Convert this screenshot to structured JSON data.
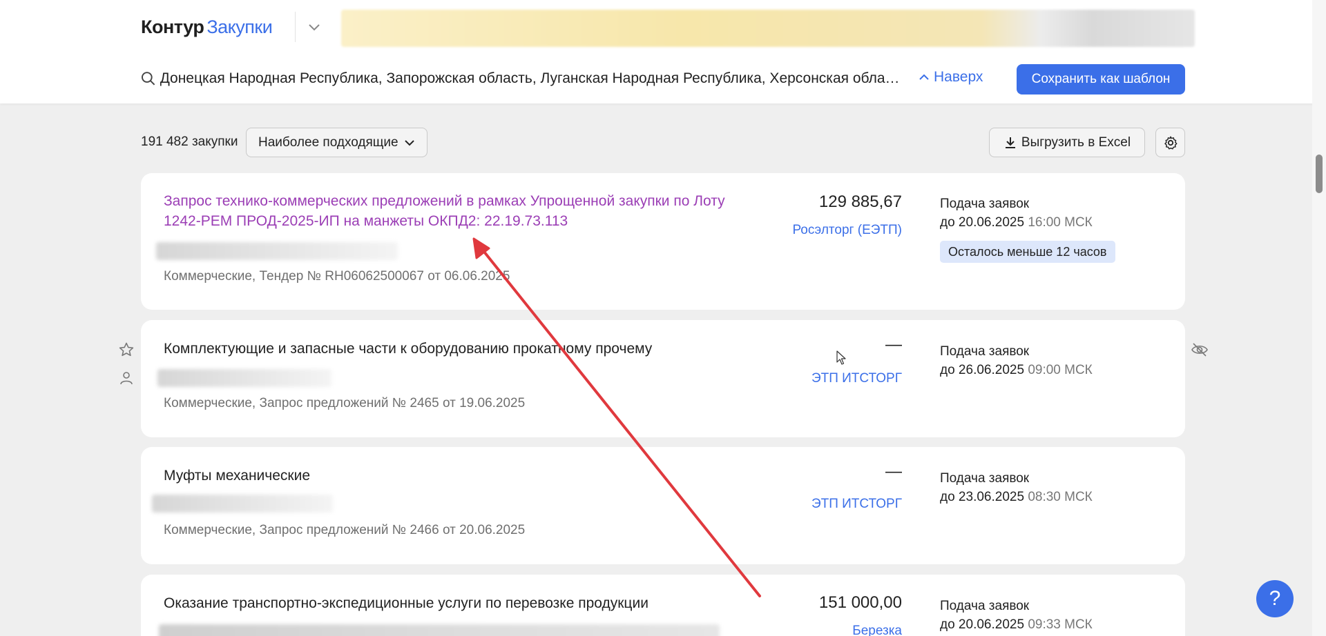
{
  "header": {
    "logo_primary": "Контур",
    "logo_secondary": "Закупки",
    "search_text": "Донецкая Народная Республика, Запорожская область, Луганская Народная Республика, Херсонская область",
    "up_label": "Наверх",
    "save_template_label": "Сохранить как шаблон"
  },
  "toolbar": {
    "count": "191 482 закупки",
    "sort_label": "Наиболее подходящие",
    "excel_label": "Выгрузить в Excel"
  },
  "cards": [
    {
      "title": "Запрос технико-коммерческих предложений в рамках Упрощенной закупки по Лоту 1242-РЕМ ПРОД-2025-ИП на манжеты ОКПД2: 22.19.73.113",
      "meta": "Коммерческие, Тендер № RH06062500067 от 06.06.2025",
      "price": "129 885,67",
      "platform": "Росэлторг (ЕЭТП)",
      "deadline_label": "Подача заявок",
      "deadline_date": "до 20.06.2025",
      "deadline_time": "16:00 МСК",
      "badge": "Осталось меньше 12 часов"
    },
    {
      "title": "Комплектующие и запасные части к оборудованию прокатному прочему",
      "meta": "Коммерческие, Запрос предложений № 2465 от 19.06.2025",
      "price": "—",
      "platform": "ЭТП ИТСТОРГ",
      "deadline_label": "Подача заявок",
      "deadline_date": "до 26.06.2025",
      "deadline_time": "09:00 МСК"
    },
    {
      "title": "Муфты механические",
      "meta": "Коммерческие, Запрос предложений № 2466 от 20.06.2025",
      "price": "—",
      "platform": "ЭТП ИТСТОРГ",
      "deadline_label": "Подача заявок",
      "deadline_date": "до 23.06.2025",
      "deadline_time": "08:30 МСК"
    },
    {
      "title": "Оказание транспортно-экспедиционные услуги по перевозке продукции",
      "price": "151 000,00",
      "platform": "Березка",
      "deadline_label": "Подача заявок",
      "deadline_date": "до 20.06.2025",
      "deadline_time": "09:33 МСК"
    }
  ],
  "help": {
    "label": "?"
  },
  "colors": {
    "accent": "#3b6fe8",
    "visited_link": "#9b3eb5",
    "annotation_arrow": "#e0393e",
    "badge_bg": "#dde7fb"
  }
}
